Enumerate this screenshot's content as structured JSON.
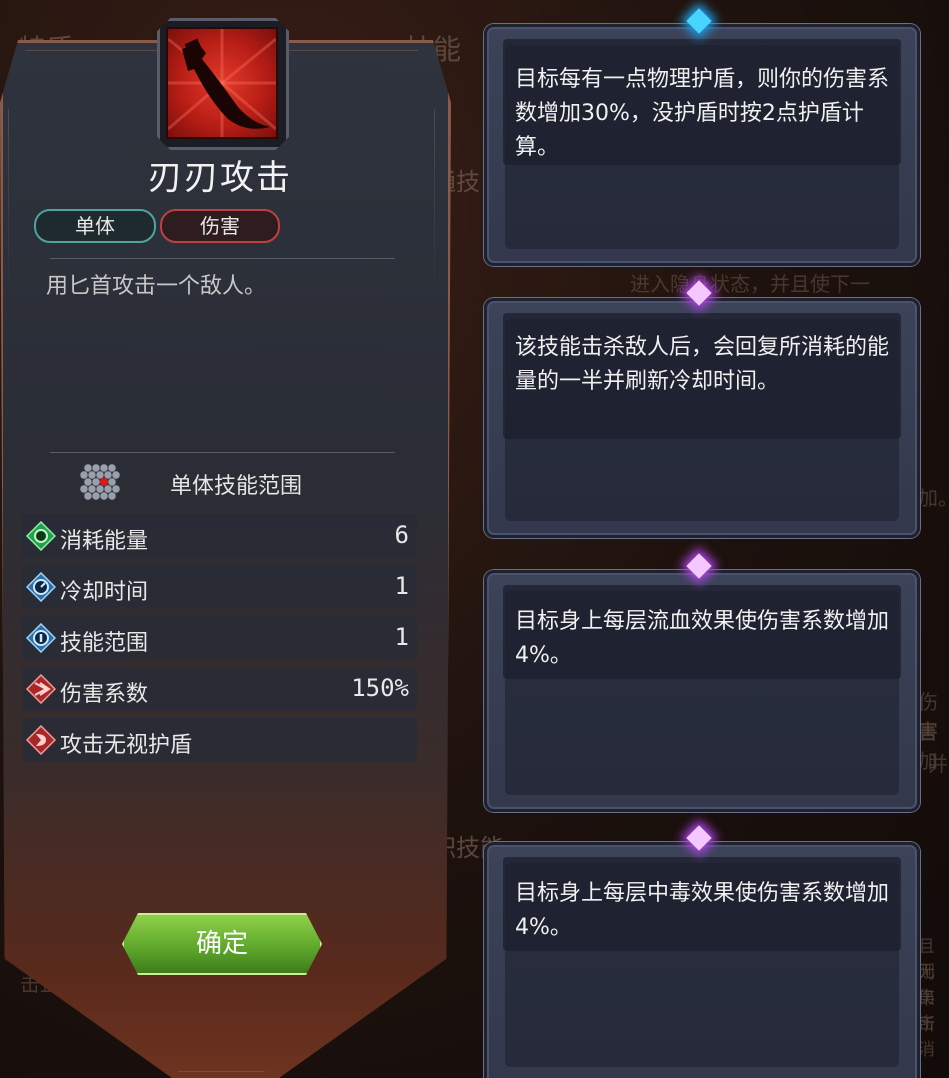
{
  "background": {
    "tab_feature": "特质",
    "tab_skill": "技能",
    "common_skill": "通技",
    "job_skill": "职技能",
    "partial_lines": [
      "进入隐身状态，并且使下一",
      "加。",
      "伤害",
      "害加",
      "并",
      "击且无伤",
      "且无",
      "则伤",
      "果击",
      "所消"
    ]
  },
  "card": {
    "title": "刃刃攻击",
    "tags": [
      "单体",
      "伤害"
    ],
    "description": "用匕首攻击一个敌人。",
    "range_label": "单体技能范围",
    "stats": [
      {
        "label": "消耗能量",
        "value": "6",
        "icon": "energy-icon"
      },
      {
        "label": "冷却时间",
        "value": "1",
        "icon": "cooldown-icon"
      },
      {
        "label": "技能范围",
        "value": "1",
        "icon": "range-icon"
      },
      {
        "label": "伤害系数",
        "value": "150%",
        "icon": "damage-icon"
      },
      {
        "label": "攻击无视护盾",
        "value": "",
        "icon": "pierce-shield-icon"
      }
    ],
    "confirm_label": "确定"
  },
  "tooltips": [
    {
      "text": "目标每有一点物理护盾，则你的伤害系数增加30%，没护盾时按2点护盾计算。",
      "gem": "blue"
    },
    {
      "text": "该技能击杀敌人后，会回复所消耗的能量的一半并刷新冷却时间。",
      "gem": "purple"
    },
    {
      "text": "目标身上每层流血效果使伤害系数增加4%。",
      "gem": "purple"
    },
    {
      "text": "目标身上每层中毒效果使伤害系数增加4%。",
      "gem": "purple"
    }
  ],
  "colors": {
    "accent_green": "#5ba52a",
    "tag_single": "#4fa3a0",
    "tag_damage": "#c04040",
    "gem_blue": "#48d4ff",
    "gem_purple": "#b045e8"
  }
}
